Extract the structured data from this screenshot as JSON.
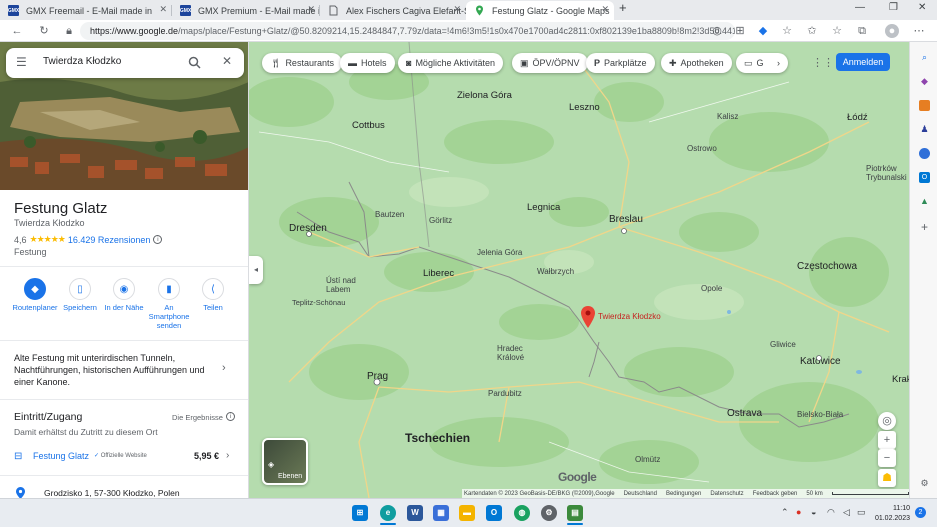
{
  "browser": {
    "tabs": [
      {
        "title": "GMX Freemail - E-Mail made in",
        "favicon": "GMX"
      },
      {
        "title": "GMX Premium - E-Mail made in",
        "favicon": "GMX"
      },
      {
        "title": "Alex Fischers Cagiva Elefant-Seite",
        "favicon": "page"
      },
      {
        "title": "Festung Glatz - Google Maps",
        "favicon": "maps-pin",
        "active": true
      }
    ],
    "url_host": "https://www.google.de",
    "url_path": "/maps/place/Festung+Glatz/@50.8209214,15.2484847,7.79z/data=!4m6!3m5!1s0x470e1700ad4c2811:0xf802139e1ba8809b!8m2!3d50.441..."
  },
  "panel": {
    "search_value": "Twierdza Kłodzko",
    "place_name": "Festung Glatz",
    "place_alt_name": "Twierdza Kłodzko",
    "rating": "4,6",
    "stars": "★★★★★",
    "reviews": "16.429 Rezensionen",
    "place_type": "Festung",
    "actions": [
      {
        "label": "Routenplaner",
        "icon": "directions-icon"
      },
      {
        "label": "Speichern",
        "icon": "bookmark-icon"
      },
      {
        "label": "In der Nähe",
        "icon": "nearby-icon"
      },
      {
        "label": "An Smartphone senden",
        "icon": "phone-icon"
      },
      {
        "label": "Teilen",
        "icon": "share-icon"
      }
    ],
    "description": "Alte Festung mit unterirdischen Tunneln, Nachtführungen, historischen Aufführungen und einer Kanone.",
    "entry": {
      "title": "Eintritt/Zugang",
      "note": "Die Ergebnisse",
      "subtitle": "Damit erhältst du Zutritt zu diesem Ort",
      "ticket_name": "Festung Glatz",
      "ticket_badge": "Offizielle Website",
      "ticket_price": "5,95 €"
    },
    "address": "Grodzisko 1, 57-300 Kłodzko, Polen"
  },
  "map": {
    "chips": [
      "Restaurants",
      "Hotels",
      "Mögliche Aktivitäten",
      "ÖPV/ÖPNV",
      "Parkplätze",
      "Apotheken",
      "G"
    ],
    "login_label": "Anmelden",
    "pin_label": "Twierdza Kłodzko",
    "layers_label": "Ebenen",
    "google_logo": "Google",
    "cities": {
      "zielona_gora": "Zielona Góra",
      "leszno": "Leszno",
      "kalisz": "Kalisz",
      "lodz": "Łódź",
      "cottbus": "Cottbus",
      "ostrowo": "Ostrowo",
      "piotrkow": "Piotrków Trybunalski",
      "bautzen": "Bautzen",
      "gorlitz": "Görlitz",
      "legnica": "Legnica",
      "breslau": "Breslau",
      "dresden": "Dresden",
      "jelenia": "Jelenia Góra",
      "liberec": "Liberec",
      "walbrzych": "Wałbrzych",
      "czestochowa": "Częstochowa",
      "usti": "Ústí nad Labem",
      "opole": "Opole",
      "teplitz": "Teplitz-Schönau",
      "hradec": "Hradec Králové",
      "gliwice": "Gliwice",
      "katowice": "Katowice",
      "prag": "Prag",
      "pardubitz": "Pardubitz",
      "ostrava": "Ostrava",
      "bielsko": "Bielsko-Biała",
      "tschechien": "Tschechien",
      "olmutz": "Olmütz",
      "krakow": "Krak"
    },
    "footer": [
      "Kartendaten © 2023 GeoBasis-DE/BKG (©2009),Google",
      "Deutschland",
      "Bedingungen",
      "Datenschutz",
      "Feedback geben",
      "50 km"
    ]
  },
  "taskbar": {
    "time": "11:10",
    "date": "01.02.2023",
    "notifications": "2"
  }
}
